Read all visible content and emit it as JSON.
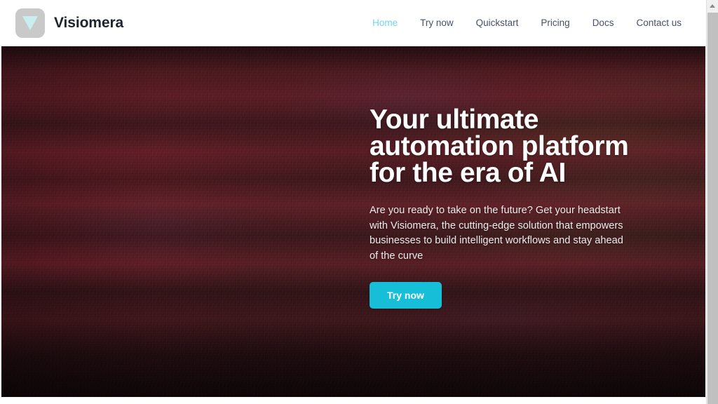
{
  "site": {
    "brand_name": "Visiomera",
    "logo_icon": "triangle-down-icon",
    "logo_bg_color": "#c9c9c9",
    "logo_glyph_color": "#c8eef0"
  },
  "header": {
    "nav_items": [
      {
        "label": "Home",
        "active": true
      },
      {
        "label": "Try now",
        "active": false
      },
      {
        "label": "Quickstart",
        "active": false
      },
      {
        "label": "Pricing",
        "active": false
      },
      {
        "label": "Docs",
        "active": false
      },
      {
        "label": "Contact us",
        "active": false
      }
    ],
    "active_color": "#76d3ea",
    "link_color": "#46506b",
    "background": "#ffffff"
  },
  "hero": {
    "title": "Your ultimate automation platform for the era of AI",
    "subtitle": "Are you ready to take on the future? Get your headstart with Visiomera, the cutting-edge solution that empowers businesses to build intelligent workflows and stay ahead of the curve",
    "cta_label": "Try now",
    "cta_color": "#17bed8",
    "cta_text_color": "#ffffff",
    "background_description": "dark maroon red textured photo background",
    "background_base_color": "#4a1f22",
    "title_color": "#ffffff",
    "subtitle_color": "#f2ecec"
  },
  "scrollbar": {
    "up_arrow_icon": "triangle-up-icon",
    "track_color": "#f0f0f0",
    "thumb_color": "#c0c0c0"
  }
}
